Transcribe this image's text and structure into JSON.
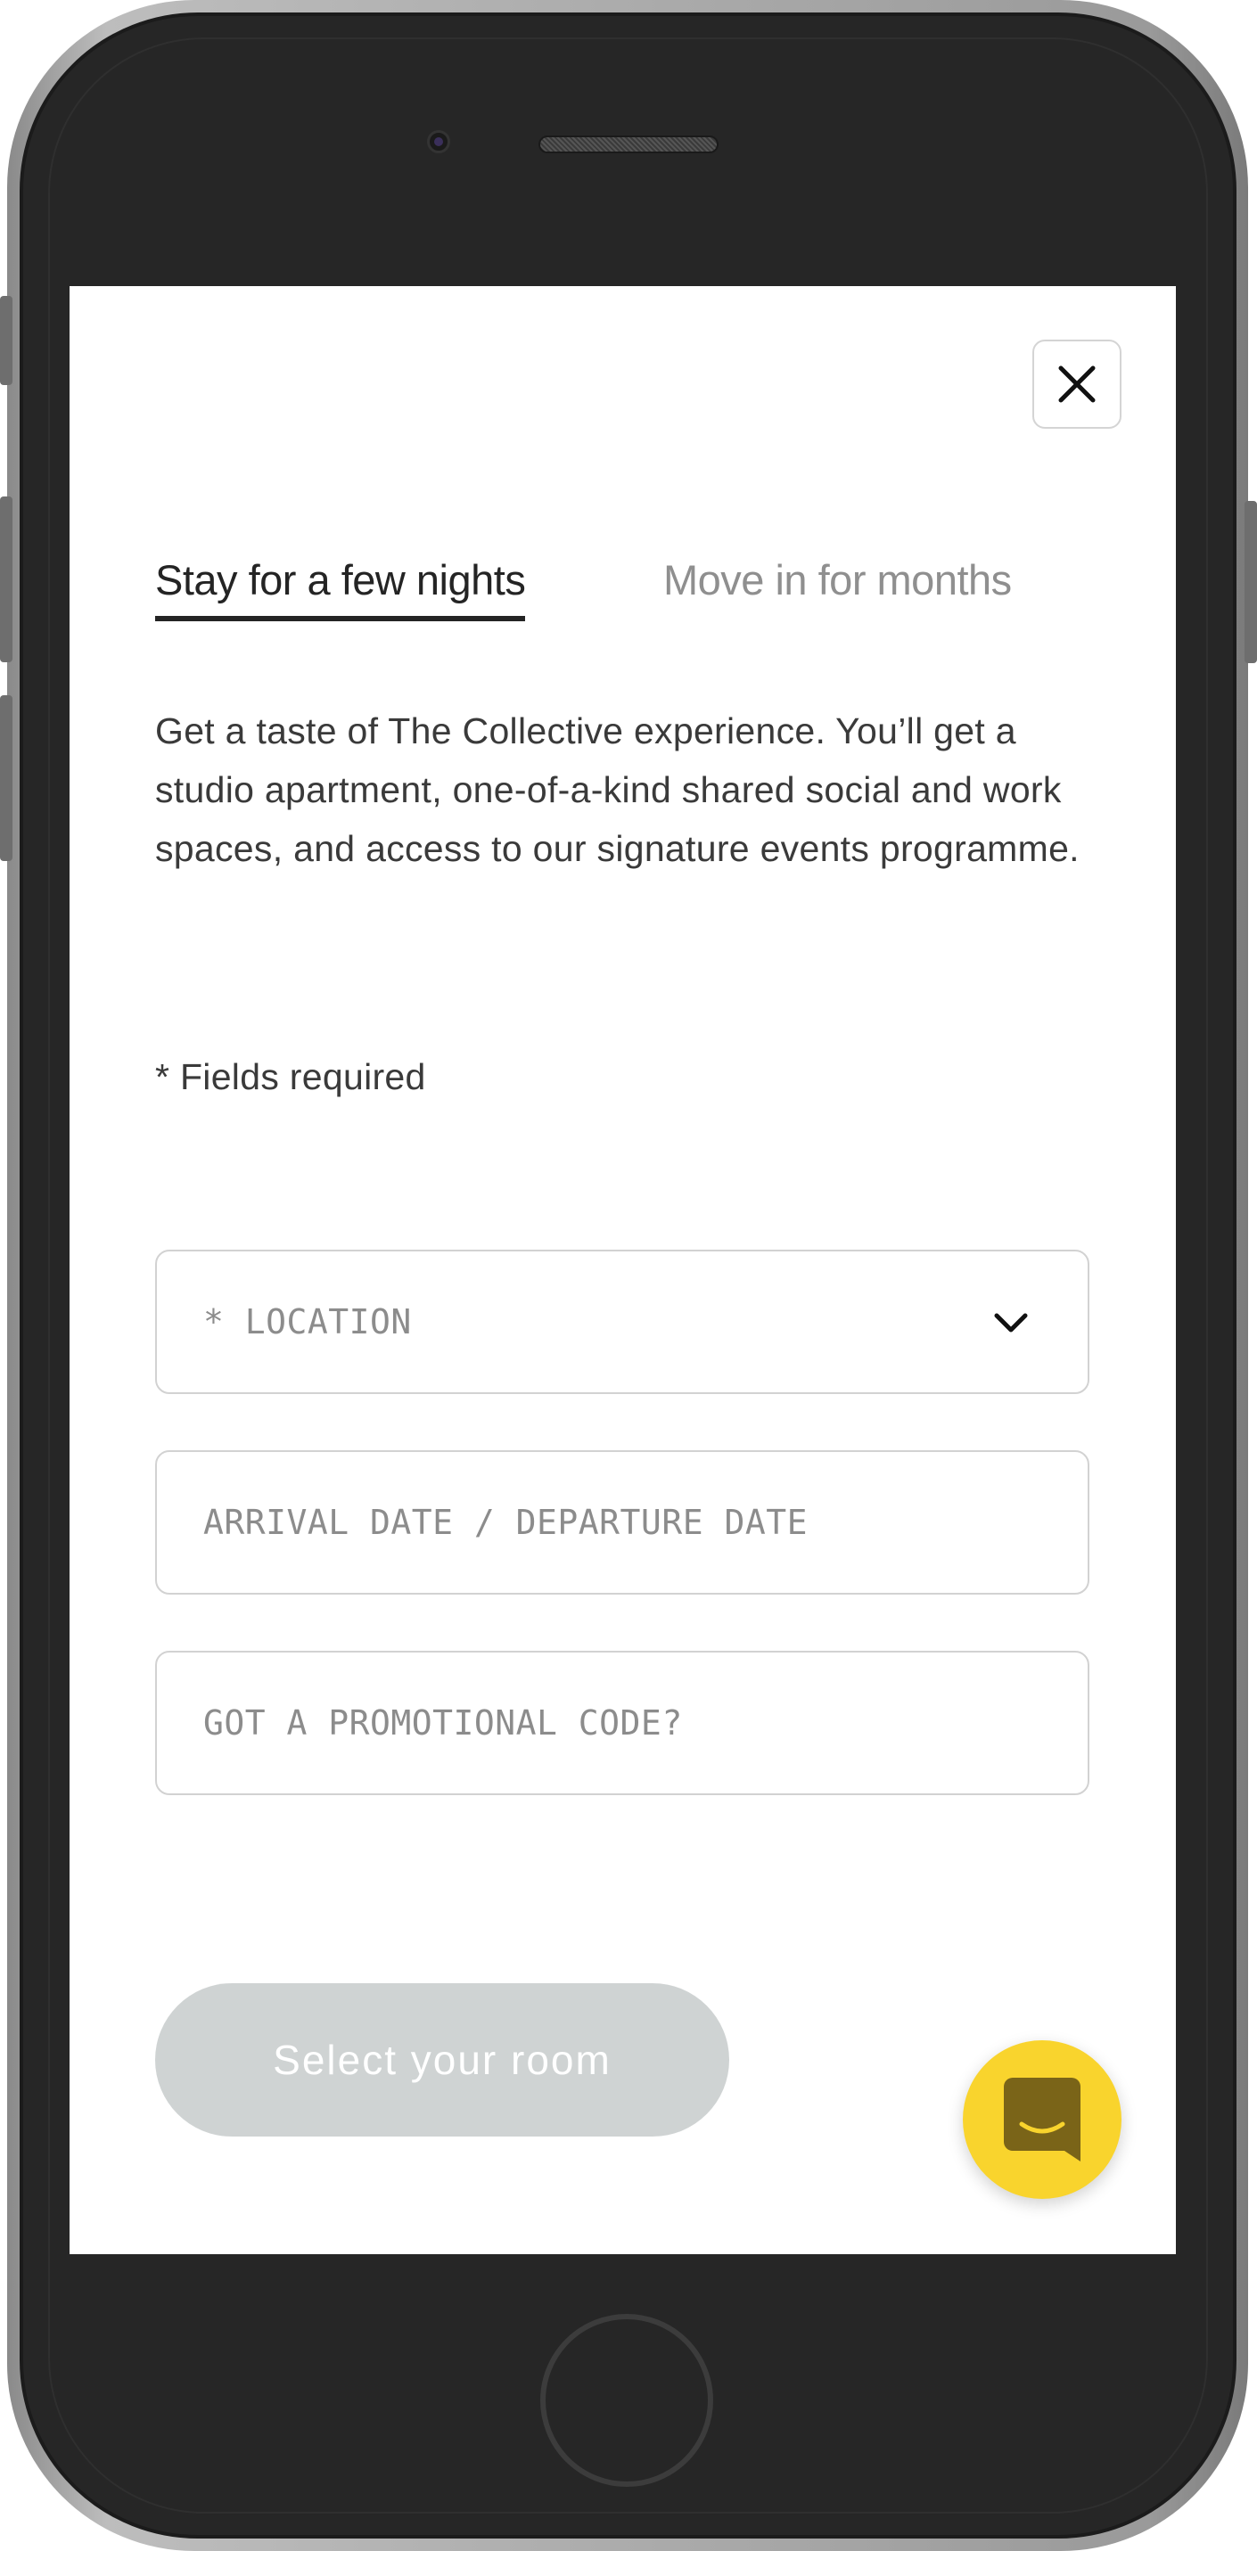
{
  "modal": {
    "close_label": "Close"
  },
  "tabs": [
    {
      "label": "Stay for a few nights",
      "active": true
    },
    {
      "label": "Move in for months",
      "active": false
    }
  ],
  "intro_text": "Get a taste of The Collective experience. You’ll get a studio apartment, one-of-a-kind shared social and work spaces, and access to our signature events programme.",
  "required_note": "* Fields required",
  "form": {
    "location_placeholder": "* LOCATION",
    "dates_placeholder": "ARRIVAL DATE / DEPARTURE DATE",
    "promo_placeholder": "GOT A PROMOTIONAL CODE?"
  },
  "cta": {
    "label": "Select your room"
  },
  "chat": {
    "icon": "chat-smile-icon",
    "color": "#F9D42D"
  },
  "colors": {
    "button_disabled": "#CFD3D3",
    "text_primary": "#242424",
    "text_muted": "#8F8F8F"
  }
}
